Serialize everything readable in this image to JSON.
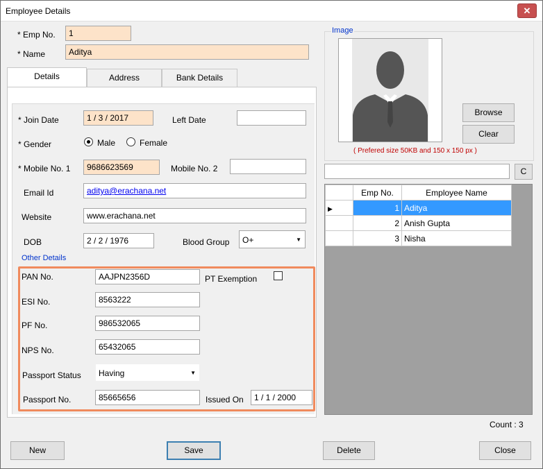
{
  "window": {
    "title": "Employee Details",
    "close_glyph": "✕"
  },
  "header": {
    "emp_no_label": "* Emp No.",
    "emp_no_value": "1",
    "name_label": "* Name",
    "name_value": "Aditya"
  },
  "tabs": [
    {
      "label": "Details",
      "active": true
    },
    {
      "label": "Address",
      "active": false
    },
    {
      "label": "Bank Details",
      "active": false
    }
  ],
  "details": {
    "join_date_label": "* Join Date",
    "join_date_value": "1 / 3 / 2017",
    "left_date_label": "Left Date",
    "left_date_value": "",
    "gender_label": "* Gender",
    "gender_options": [
      {
        "label": "Male",
        "checked": true
      },
      {
        "label": "Female",
        "checked": false
      }
    ],
    "mobile1_label": "* Mobile No. 1",
    "mobile1_value": "9686623569",
    "mobile2_label": "Mobile No. 2",
    "mobile2_value": "",
    "email_label": "Email Id",
    "email_value": "aditya@erachana.net",
    "website_label": "Website",
    "website_value": "www.erachana.net",
    "dob_label": "DOB",
    "dob_value": "2 / 2 / 1976",
    "blood_group_label": "Blood Group",
    "blood_group_value": "O+"
  },
  "other_details": {
    "group_title": "Other Details",
    "pan_label": "PAN No.",
    "pan_value": "AAJPN2356D",
    "pt_exemption_label": "PT Exemption",
    "pt_exemption_checked": false,
    "esi_label": "ESI No.",
    "esi_value": "8563222",
    "pf_label": "PF No.",
    "pf_value": "986532065",
    "nps_label": "NPS No.",
    "nps_value": "65432065",
    "passport_status_label": "Passport Status",
    "passport_status_value": "Having",
    "passport_no_label": "Passport No.",
    "passport_no_value": "85665656",
    "issued_on_label": "Issued On",
    "issued_on_value": "1 / 1 / 2000"
  },
  "image_panel": {
    "group_title": "Image",
    "browse_label": "Browse",
    "clear_label": "Clear",
    "size_hint": "( Prefered size 50KB and 150 x 150 px )"
  },
  "search": {
    "value": "",
    "clear_button_label": "C"
  },
  "grid": {
    "columns": [
      "Emp No.",
      "Employee Name"
    ],
    "rows": [
      {
        "emp_no": "1",
        "name": "Aditya",
        "selected": true
      },
      {
        "emp_no": "2",
        "name": "Anish Gupta",
        "selected": false
      },
      {
        "emp_no": "3",
        "name": "Nisha",
        "selected": false
      }
    ],
    "count_text": "Count : 3"
  },
  "footer": {
    "new_label": "New",
    "save_label": "Save",
    "delete_label": "Delete",
    "close_label": "Close"
  },
  "colors": {
    "required_field": "#fde3c9",
    "selection": "#3399ff",
    "group_title": "#0033cc",
    "highlight": "#f08a5d"
  }
}
